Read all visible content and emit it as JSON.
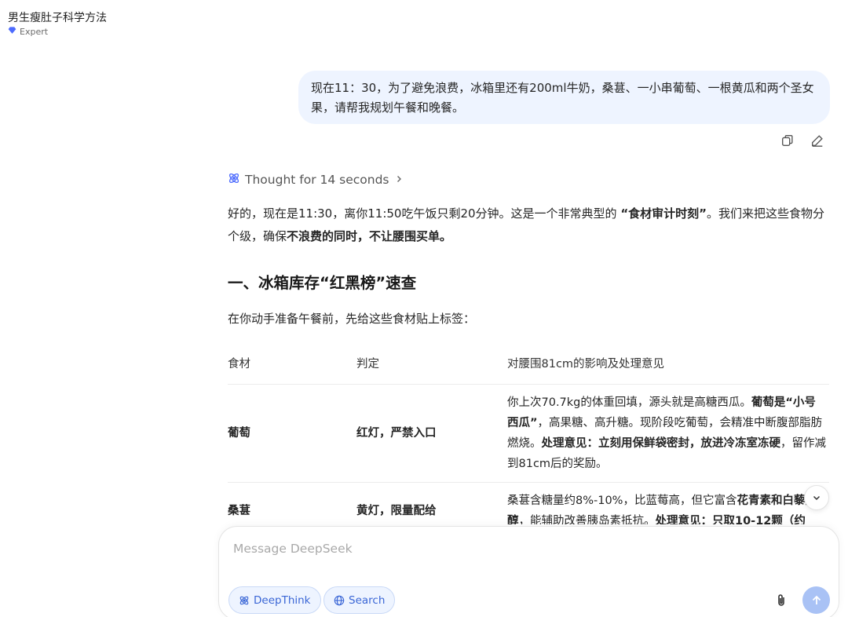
{
  "conversation": {
    "title": "男生瘦肚子科学方法",
    "model_badge": "Expert"
  },
  "user_message": {
    "text": "现在11：30，为了避免浪费，冰箱里还有200ml牛奶，桑葚、一小串葡萄、一根黄瓜和两个圣女果，请帮我规划午餐和晚餐。",
    "actions": {
      "copy_icon": "copy-icon",
      "edit_icon": "edit-icon"
    }
  },
  "assistant": {
    "thought_label": "Thought for 14 seconds",
    "para1_a": "好的，现在是11:30，离你11:50吃午饭只剩20分钟。这是一个非常典型的 ",
    "para1_b": "“食材审计时刻”",
    "para1_c": "。我们来把这些食物分个级，确保",
    "para1_d": "不浪费的同时，不让腰围买单。",
    "heading": "一、冰箱库存“红黑榜”速查",
    "intro": "在你动手准备午餐前，先给这些食材贴上标签：",
    "table": {
      "headers": [
        "食材",
        "判定",
        "对腰围81cm的影响及处理意见"
      ],
      "rows": [
        {
          "food": "葡萄",
          "verdict": "红灯，严禁入口",
          "note_a": "你上次70.7kg的体重回填，源头就是高糖西瓜。",
          "note_b": "葡萄是“小号西瓜”",
          "note_c": "，高果糖、高升糖。现阶段吃葡萄，会精准中断腹部脂肪燃烧。",
          "note_d": "处理意见：立刻用保鲜袋密封，放进冷冻室冻硬",
          "note_e": "，留作减到81cm后的奖励。"
        },
        {
          "food": "桑葚",
          "verdict": "黄灯，限量配给",
          "note_a": "桑葚含糖量约8%-10%，比蓝莓高，但它富含",
          "note_b": "花青素和白藜芦醇",
          "note_c": "，能辅助改善胰岛素抵抗。",
          "note_d": "处理意见：只取10-12颗（约",
          "note_e": ""
        }
      ]
    }
  },
  "composer": {
    "placeholder": "Message DeepSeek",
    "deepthink_label": "DeepThink",
    "search_label": "Search"
  },
  "colors": {
    "accent": "#3a66d6",
    "user_bubble": "#eef4ff",
    "send_button": "#a9c2f5"
  }
}
